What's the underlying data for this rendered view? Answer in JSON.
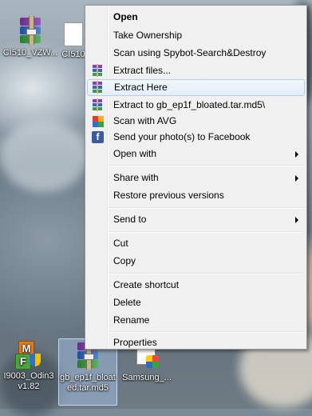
{
  "desktop": {
    "icons": [
      {
        "label": "CI510_VZW..."
      },
      {
        "label": "CI510"
      },
      {
        "label": "I9003_Odin3 v1.82"
      },
      {
        "label": "gb_ep1f_bloated.tar.md5"
      },
      {
        "label": "Samsung_..."
      }
    ]
  },
  "menu": {
    "items": [
      {
        "label": "Open"
      },
      {
        "label": "Take Ownership"
      },
      {
        "label": "Scan using Spybot-Search&Destroy"
      },
      {
        "label": "Extract files..."
      },
      {
        "label": "Extract Here"
      },
      {
        "label": "Extract to gb_ep1f_bloated.tar.md5\\"
      },
      {
        "label": "Scan with AVG"
      },
      {
        "label": "Send your photo(s) to Facebook"
      },
      {
        "label": "Open with"
      },
      {
        "label": "Share with"
      },
      {
        "label": "Restore previous versions"
      },
      {
        "label": "Send to"
      },
      {
        "label": "Cut"
      },
      {
        "label": "Copy"
      },
      {
        "label": "Create shortcut"
      },
      {
        "label": "Delete"
      },
      {
        "label": "Rename"
      },
      {
        "label": "Properties"
      }
    ]
  },
  "colors": {
    "menu_bg": "#f0f0f0",
    "hover_border": "#aecff7",
    "facebook": "#3b5ba0"
  }
}
